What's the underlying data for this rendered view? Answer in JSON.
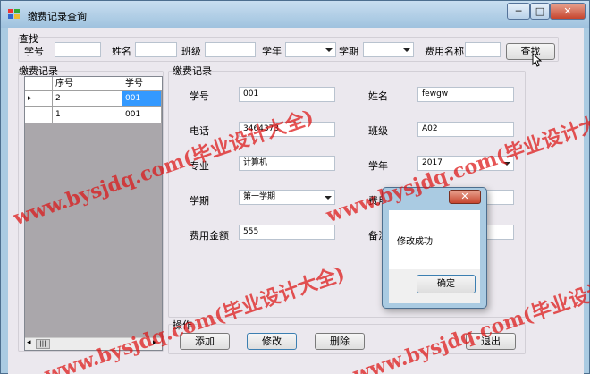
{
  "window": {
    "title": "缴费记录查询",
    "controls": {
      "minimize": "─",
      "maximize": "□",
      "close": "✕"
    }
  },
  "search": {
    "group_label": "查找",
    "student_id_label": "学号",
    "name_label": "姓名",
    "class_label": "班级",
    "year_label": "学年",
    "term_label": "学期",
    "fee_name_label": "费用名称",
    "button": "查找",
    "student_id_value": "",
    "name_value": "",
    "class_value": "",
    "year_value": "",
    "term_value": "",
    "fee_name_value": ""
  },
  "records": {
    "group_label": "缴费记录",
    "columns": [
      "序号",
      "学号"
    ],
    "rows": [
      {
        "seq": "2",
        "id": "001",
        "selected": true
      },
      {
        "seq": "1",
        "id": "001",
        "selected": false
      }
    ],
    "row_marker": "▸",
    "scroll_left": "◂",
    "scroll_right": "▸",
    "scroll_thumb": "|||"
  },
  "detail": {
    "group_label": "缴费记录",
    "student_id_label": "学号",
    "student_id": "001",
    "name_label": "姓名",
    "name": "fewgw",
    "phone_label": "电话",
    "phone": "3464373",
    "class_label": "班级",
    "class": "A02",
    "major_label": "专业",
    "major": "计算机",
    "year_label": "学年",
    "year": "2017",
    "term_label": "学期",
    "term": "第一学期",
    "fee_name_label": "费用",
    "fee_name": "",
    "amount_label": "费用金额",
    "amount": "555",
    "remark_label": "备注",
    "remark": ""
  },
  "actions": {
    "group_label": "操作",
    "add": "添加",
    "edit": "修改",
    "delete": "删除",
    "exit": "退出"
  },
  "dialog": {
    "close": "✕",
    "message": "修改成功",
    "ok": "确定"
  },
  "watermark": "www.bysjdq.com(毕业设计大全)",
  "colors": {
    "selection": "#3399ff",
    "watermark": "#dc1414",
    "titlebar": "#aacbe2"
  }
}
